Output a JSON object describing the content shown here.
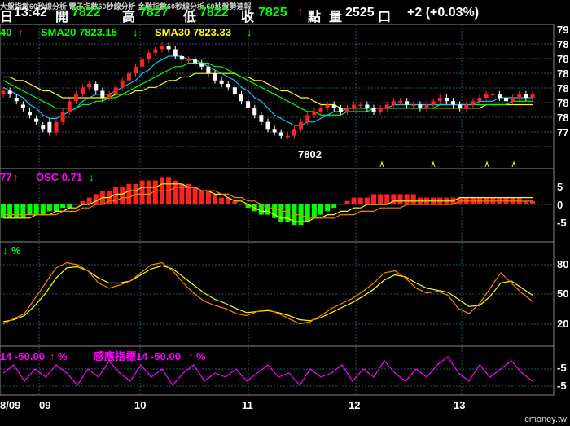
{
  "header": {
    "ticker_text": "大盤指數60秒線分析 電子指數60秒線分析 金融指數60秒線分析 60秒盤勢速報",
    "day_label": "日",
    "time": "13:42",
    "open_label": "開",
    "open": "7822",
    "high_label": "高",
    "high": "7827",
    "low_label": "低",
    "low": "7822",
    "close_label": "收",
    "close": "7825",
    "arrow": "↑",
    "points_label": "點",
    "volume_label": "量",
    "volume": "2525",
    "unit_label": "口",
    "change": "+2 (+0.03%)"
  },
  "legends": {
    "ma_prefix": "40",
    "sma20": "SMA20 7823.15",
    "sma30": "SMA30 7823.33",
    "macd_prefix": "77",
    "osc": "OSC 0.71",
    "kd_prefix": "%",
    "sens_prefix": "14 -50.00",
    "sens_pct": "%",
    "sens_label": "感應指標14 -50.00",
    "sens_pct2": "%",
    "up_arrow": "↑",
    "down_arrow": "↓"
  },
  "logo": "cmoney.tw",
  "colors": {
    "up": "#ff2020",
    "down": "#00ff00",
    "osc_label": "#ff00ff",
    "sma20": "#00ff00",
    "sma30": "#ffff00",
    "grid": "#1e5a6a"
  },
  "chart_data": [
    {
      "type": "candlestick",
      "y_ticks": [
        "79",
        "78",
        "78",
        "78",
        "78",
        "78",
        "78",
        "77"
      ],
      "annotation": "7802",
      "note_y_range": [
        7795,
        7835
      ],
      "closes": [
        7817,
        7816,
        7814,
        7812,
        7810,
        7808,
        7806,
        7805,
        7808,
        7811,
        7814,
        7816,
        7818,
        7819,
        7817,
        7815,
        7816,
        7818,
        7820,
        7822,
        7824,
        7826,
        7828,
        7829,
        7830,
        7829,
        7827,
        7826,
        7826,
        7825,
        7824,
        7822,
        7820,
        7819,
        7818,
        7816,
        7814,
        7812,
        7810,
        7808,
        7806,
        7805,
        7804,
        7804,
        7806,
        7808,
        7810,
        7811,
        7812,
        7813,
        7812,
        7811,
        7812,
        7813,
        7813,
        7812,
        7811,
        7812,
        7813,
        7814,
        7814,
        7813,
        7813,
        7812,
        7813,
        7814,
        7815,
        7814,
        7813,
        7812,
        7813,
        7814,
        7815,
        7816,
        7816,
        7815,
        7814,
        7815,
        7816,
        7815,
        7816
      ],
      "opens": [
        7816,
        7817,
        7815,
        7813,
        7811,
        7809,
        7807,
        7808,
        7805,
        7808,
        7811,
        7814,
        7816,
        7818,
        7819,
        7817,
        7815,
        7816,
        7818,
        7820,
        7822,
        7824,
        7826,
        7828,
        7829,
        7830,
        7829,
        7827,
        7826,
        7826,
        7825,
        7824,
        7822,
        7820,
        7819,
        7818,
        7816,
        7814,
        7812,
        7810,
        7808,
        7806,
        7805,
        7804,
        7804,
        7806,
        7808,
        7810,
        7811,
        7812,
        7813,
        7812,
        7811,
        7812,
        7813,
        7813,
        7812,
        7811,
        7812,
        7813,
        7814,
        7814,
        7813,
        7813,
        7812,
        7813,
        7814,
        7815,
        7814,
        7813,
        7812,
        7813,
        7814,
        7815,
        7816,
        7816,
        7815,
        7814,
        7815,
        7816,
        7815
      ],
      "sma10": [
        7818,
        7817,
        7816,
        7815,
        7813,
        7812,
        7810,
        7809,
        7809,
        7810,
        7811,
        7812,
        7814,
        7815,
        7816,
        7816,
        7816,
        7817,
        7818,
        7819,
        7820,
        7822,
        7823,
        7825,
        7826,
        7827,
        7827,
        7827,
        7826,
        7826,
        7825,
        7824,
        7823,
        7822,
        7821,
        7820,
        7818,
        7817,
        7815,
        7814,
        7812,
        7810,
        7809,
        7808,
        7807,
        7807,
        7808,
        7808,
        7809,
        7810,
        7811,
        7811,
        7812,
        7812,
        7812,
        7812,
        7812,
        7812,
        7812,
        7813,
        7813,
        7813,
        7813,
        7813,
        7813,
        7813,
        7813,
        7813,
        7813,
        7813,
        7813,
        7813,
        7814,
        7814,
        7814,
        7815,
        7815,
        7815,
        7815,
        7815,
        7815
      ],
      "sma20": [
        7820,
        7819,
        7818,
        7817,
        7816,
        7815,
        7814,
        7813,
        7812,
        7812,
        7812,
        7812,
        7813,
        7813,
        7814,
        7814,
        7815,
        7815,
        7816,
        7817,
        7818,
        7819,
        7820,
        7821,
        7822,
        7823,
        7824,
        7824,
        7825,
        7825,
        7825,
        7825,
        7824,
        7824,
        7823,
        7822,
        7821,
        7820,
        7819,
        7818,
        7817,
        7816,
        7815,
        7814,
        7813,
        7812,
        7811,
        7811,
        7810,
        7810,
        7810,
        7810,
        7811,
        7811,
        7811,
        7811,
        7812,
        7812,
        7812,
        7812,
        7812,
        7812,
        7812,
        7812,
        7812,
        7812,
        7813,
        7813,
        7813,
        7813,
        7813,
        7813,
        7813,
        7813,
        7813,
        7813,
        7813,
        7814,
        7814,
        7814,
        7814
      ],
      "sma30": [
        7821,
        7821,
        7820,
        7820,
        7819,
        7818,
        7817,
        7817,
        7816,
        7815,
        7815,
        7815,
        7815,
        7815,
        7815,
        7815,
        7815,
        7816,
        7816,
        7816,
        7817,
        7817,
        7818,
        7818,
        7819,
        7820,
        7820,
        7821,
        7821,
        7822,
        7822,
        7822,
        7822,
        7822,
        7822,
        7822,
        7821,
        7821,
        7820,
        7820,
        7819,
        7818,
        7817,
        7817,
        7816,
        7815,
        7815,
        7814,
        7813,
        7813,
        7813,
        7812,
        7812,
        7812,
        7812,
        7812,
        7812,
        7812,
        7812,
        7812,
        7812,
        7812,
        7812,
        7812,
        7812,
        7812,
        7812,
        7812,
        7812,
        7812,
        7812,
        7812,
        7812,
        7813,
        7813,
        7813,
        7813,
        7813,
        7813,
        7813,
        7813
      ]
    },
    {
      "type": "bar",
      "y_ticks": [
        "5",
        "0",
        "-5"
      ],
      "osc": [
        -4,
        -4,
        -4,
        -4,
        -3,
        -3,
        -3,
        -2,
        -2,
        -1,
        -1,
        0,
        1,
        2,
        3,
        4,
        4,
        5,
        5,
        6,
        6,
        7,
        7,
        7,
        8,
        8,
        7,
        6,
        6,
        5,
        4,
        4,
        3,
        2,
        2,
        1,
        0,
        -1,
        -2,
        -3,
        -3,
        -4,
        -5,
        -5,
        -6,
        -6,
        -5,
        -4,
        -3,
        -2,
        -1,
        0,
        1,
        2,
        2,
        2,
        3,
        3,
        3,
        3,
        3,
        3,
        3,
        2,
        2,
        2,
        2,
        2,
        2,
        2,
        2,
        2,
        2,
        2,
        2,
        2,
        2,
        2,
        2,
        1,
        1
      ],
      "dif": [
        -4,
        -4,
        -4,
        -4,
        -4,
        -3,
        -3,
        -3,
        -2,
        -2,
        -1,
        -1,
        0,
        0,
        1,
        2,
        2,
        3,
        3,
        4,
        4,
        5,
        5,
        5,
        6,
        6,
        6,
        6,
        5,
        5,
        4,
        4,
        3,
        3,
        2,
        1,
        1,
        0,
        -1,
        -2,
        -2,
        -3,
        -4,
        -4,
        -5,
        -5,
        -5,
        -4,
        -4,
        -3,
        -3,
        -2,
        -2,
        -1,
        -1,
        0,
        0,
        0,
        0,
        1,
        1,
        1,
        1,
        1,
        1,
        1,
        1,
        1,
        1,
        2,
        2,
        2,
        2,
        2,
        2,
        2,
        2,
        2,
        2,
        2,
        2
      ],
      "macd": [
        -3,
        -3,
        -3,
        -3,
        -3,
        -3,
        -3,
        -3,
        -3,
        -2,
        -2,
        -2,
        -1,
        -1,
        0,
        0,
        1,
        1,
        2,
        2,
        3,
        3,
        3,
        4,
        4,
        4,
        5,
        5,
        5,
        5,
        4,
        4,
        4,
        3,
        3,
        2,
        2,
        1,
        1,
        0,
        -1,
        -1,
        -2,
        -2,
        -3,
        -3,
        -4,
        -4,
        -4,
        -4,
        -4,
        -3,
        -3,
        -3,
        -2,
        -2,
        -2,
        -1,
        -1,
        -1,
        -1,
        0,
        0,
        0,
        0,
        0,
        0,
        0,
        0,
        1,
        1,
        1,
        1,
        1,
        1,
        1,
        1,
        1,
        1,
        1,
        1
      ]
    },
    {
      "type": "line",
      "y_ticks": [
        "80",
        "50",
        "20"
      ],
      "k": [
        20,
        25,
        30,
        45,
        60,
        75,
        80,
        78,
        72,
        60,
        55,
        58,
        62,
        70,
        78,
        80,
        72,
        60,
        50,
        42,
        38,
        35,
        30,
        28,
        32,
        34,
        30,
        25,
        20,
        22,
        28,
        35,
        40,
        45,
        52,
        60,
        70,
        72,
        65,
        55,
        50,
        52,
        48,
        35,
        30,
        40,
        55,
        70,
        60,
        50,
        42
      ],
      "d": [
        22,
        24,
        28,
        38,
        50,
        65,
        75,
        76,
        72,
        65,
        60,
        60,
        62,
        68,
        74,
        77,
        74,
        66,
        58,
        50,
        44,
        40,
        35,
        31,
        32,
        33,
        31,
        28,
        24,
        23,
        26,
        31,
        36,
        41,
        47,
        54,
        63,
        68,
        66,
        60,
        55,
        53,
        51,
        44,
        37,
        38,
        47,
        60,
        62,
        55,
        48
      ]
    },
    {
      "type": "line",
      "y_ticks": [
        "-5",
        "-5"
      ],
      "values": [
        -30,
        -20,
        -40,
        -25,
        -35,
        -20,
        -30,
        -45,
        -25,
        -35,
        -15,
        -30,
        -40,
        -20,
        -35,
        -25,
        -45,
        -30,
        -20,
        -40,
        -30,
        -35,
        -25,
        -40,
        -30,
        -20,
        -35,
        -30,
        -45,
        -25,
        -35,
        -30,
        -20,
        -40,
        -25,
        -35,
        -15,
        -30,
        -40,
        -25,
        -35,
        -20,
        -10,
        -30,
        -40,
        -20,
        -35,
        -25,
        -15,
        -30,
        -40
      ]
    }
  ],
  "x_axis": {
    "labels": [
      "8/09",
      "09",
      "10",
      "11",
      "12",
      "13"
    ]
  }
}
